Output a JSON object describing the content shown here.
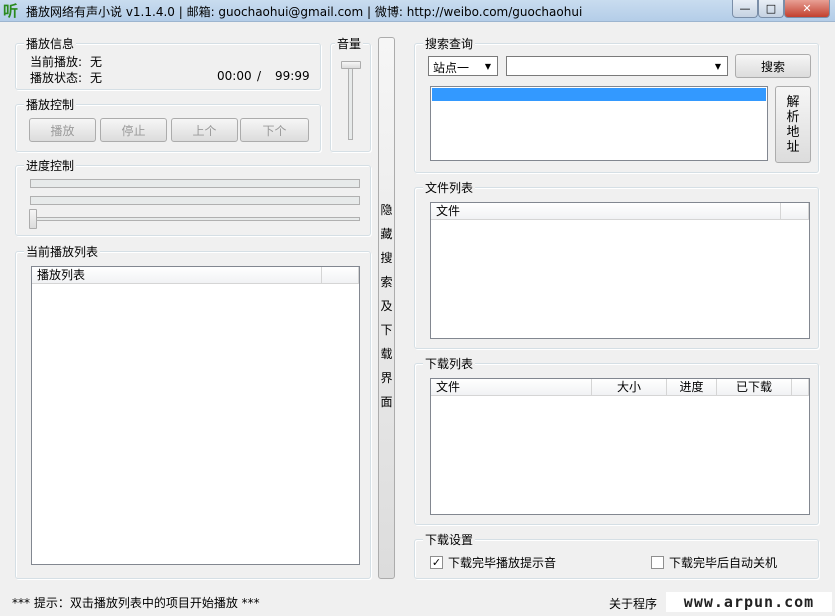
{
  "window": {
    "title": "播放网络有声小说 v1.1.4.0 | 邮箱: guochaohui@gmail.com | 微博: http://weibo.com/guochaohui",
    "icon_glyph": "听",
    "controls": {
      "minimize": "—",
      "maximize": "□",
      "close": "✕"
    }
  },
  "playback_info": {
    "legend": "播放信息",
    "current_label": "当前播放:",
    "current_value": "无",
    "status_label": "播放状态:",
    "status_value": "无",
    "time_elapsed": "00:00",
    "time_sep": "/",
    "time_total": "99:99"
  },
  "volume": {
    "legend": "音量",
    "level": 0.95
  },
  "playback_control": {
    "legend": "播放控制",
    "buttons": [
      "播放",
      "停止",
      "上个",
      "下个"
    ]
  },
  "progress_control": {
    "legend": "进度控制",
    "position": 0.0
  },
  "playlist": {
    "legend": "当前播放列表",
    "columns": [
      "播放列表"
    ]
  },
  "toggle_panel": {
    "chars": [
      "隐",
      "藏",
      "搜",
      "索",
      "及",
      "下",
      "载",
      "界",
      "面"
    ]
  },
  "search": {
    "legend": "搜索查询",
    "site_selected": "站点一",
    "query_value": "",
    "search_button": "搜索",
    "parse_button_chars": [
      "解",
      "析",
      "地",
      "址"
    ]
  },
  "file_list": {
    "legend": "文件列表",
    "columns": [
      "文件"
    ]
  },
  "download_list": {
    "legend": "下载列表",
    "columns": [
      "文件",
      "大小",
      "进度",
      "已下载"
    ]
  },
  "download_settings": {
    "legend": "下载设置",
    "option1_label": "下载完毕播放提示音",
    "option1_checked": true,
    "option2_label": "下载完毕后自动关机",
    "option2_checked": false
  },
  "status_bar": {
    "hint": "*** 提示：双击播放列表中的项目开始播放 ***",
    "about": "关于程序",
    "watermark": "www.arpun.com"
  }
}
